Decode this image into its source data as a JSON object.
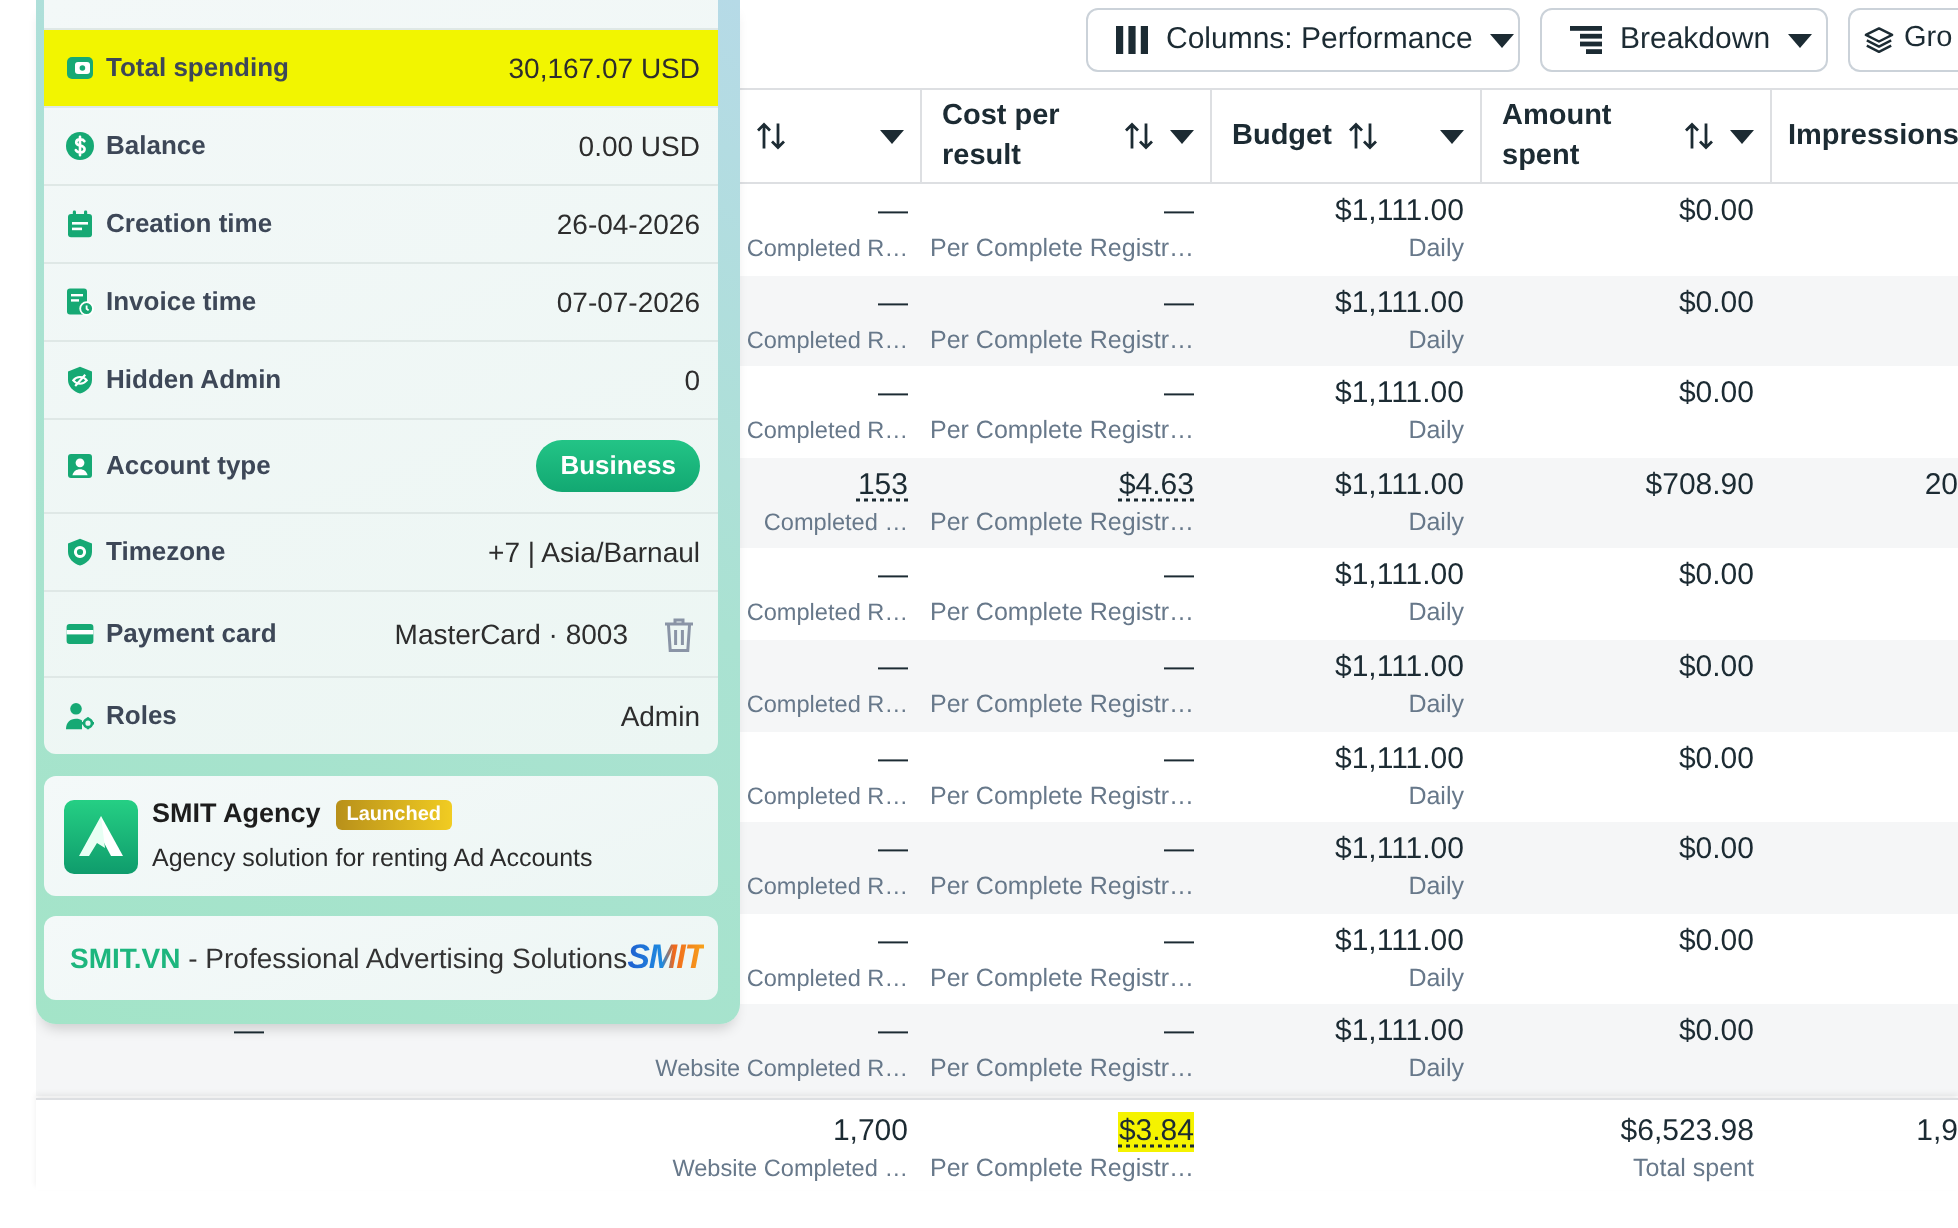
{
  "toolbar": {
    "buttons": [
      {
        "kind": "columns",
        "label": "Columns: Performance",
        "dropdown": true
      },
      {
        "kind": "breakdown",
        "label": "Breakdown",
        "dropdown": true
      },
      {
        "kind": "group",
        "label": "Gro",
        "dropdown": false
      }
    ]
  },
  "table": {
    "columns": [
      {
        "kind": "results"
      },
      {
        "kind": "cost",
        "label": "Cost per result"
      },
      {
        "kind": "budget",
        "label": "Budget"
      },
      {
        "kind": "amount",
        "label": "Amount spent"
      },
      {
        "kind": "impressions",
        "label": "Impressions"
      }
    ],
    "rows": [
      {
        "results": "—",
        "results_note": "Completed R…",
        "cost": "—",
        "cost_note": "Per Complete Registr…",
        "budget": "$1,111.00",
        "budget_note": "Daily",
        "amount": "$0.00",
        "underlined": false
      },
      {
        "results": "—",
        "results_note": "Completed R…",
        "cost": "—",
        "cost_note": "Per Complete Registr…",
        "budget": "$1,111.00",
        "budget_note": "Daily",
        "amount": "$0.00",
        "underlined": false
      },
      {
        "results": "—",
        "results_note": "Completed R…",
        "cost": "—",
        "cost_note": "Per Complete Registr…",
        "budget": "$1,111.00",
        "budget_note": "Daily",
        "amount": "$0.00",
        "underlined": false
      },
      {
        "results": "153",
        "results_note": "Completed …",
        "cost": "$4.63",
        "cost_note": "Per Complete Registr…",
        "budget": "$1,111.00",
        "budget_note": "Daily",
        "amount": "$708.90",
        "impressions": "20",
        "underlined": true
      },
      {
        "results": "—",
        "results_note": "Completed R…",
        "cost": "—",
        "cost_note": "Per Complete Registr…",
        "budget": "$1,111.00",
        "budget_note": "Daily",
        "amount": "$0.00",
        "underlined": false
      },
      {
        "results": "—",
        "results_note": "Completed R…",
        "cost": "—",
        "cost_note": "Per Complete Registr…",
        "budget": "$1,111.00",
        "budget_note": "Daily",
        "amount": "$0.00",
        "underlined": false
      },
      {
        "results": "—",
        "results_note": "Completed R…",
        "cost": "—",
        "cost_note": "Per Complete Registr…",
        "budget": "$1,111.00",
        "budget_note": "Daily",
        "amount": "$0.00",
        "underlined": false
      },
      {
        "results": "—",
        "results_note": "Completed R…",
        "cost": "—",
        "cost_note": "Per Complete Registr…",
        "budget": "$1,111.00",
        "budget_note": "Daily",
        "amount": "$0.00",
        "underlined": false
      },
      {
        "results": "—",
        "results_note": "Completed R…",
        "cost": "—",
        "cost_note": "Per Complete Registr…",
        "budget": "$1,111.00",
        "budget_note": "Daily",
        "amount": "$0.00",
        "underlined": false
      },
      {
        "column_1": "—",
        "results": "—",
        "results_note": "Website Completed R…",
        "cost": "—",
        "cost_note": "Per Complete Registr…",
        "budget": "$1,111.00",
        "budget_note": "Daily",
        "amount": "$0.00",
        "underlined": false
      }
    ],
    "footer": {
      "cells": [
        {
          "kind": "results",
          "value": "1,700",
          "note": "Website Completed …",
          "underlined": false,
          "highlighted": false
        },
        {
          "kind": "cost",
          "value": "$3.84",
          "note": "Per Complete Registr…",
          "underlined": true,
          "highlighted": true
        },
        {
          "kind": "amount",
          "value": "$6,523.98",
          "note": "Total spent",
          "underlined": false,
          "highlighted": false
        },
        {
          "kind": "impressions",
          "value": "1,9",
          "underlined": false,
          "highlighted": false
        }
      ]
    }
  },
  "account_panel": {
    "items": [
      {
        "kind": "spending",
        "label": "Total spending",
        "value": "30,167.07 USD",
        "highlighted": true
      },
      {
        "kind": "balance",
        "label": "Balance",
        "value": "0.00 USD",
        "highlighted": false
      },
      {
        "kind": "created",
        "label": "Creation time",
        "value": "26-04-2026",
        "highlighted": false
      },
      {
        "kind": "invoice",
        "label": "Invoice time",
        "value": "07-07-2026",
        "highlighted": false
      },
      {
        "kind": "admin",
        "label": "Hidden Admin",
        "value": "0",
        "highlighted": false
      },
      {
        "kind": "type",
        "label": "Account type",
        "value": "Business",
        "highlighted": false
      },
      {
        "kind": "timezone",
        "label": "Timezone",
        "value": "+7 | Asia/Barnaul",
        "highlighted": false
      },
      {
        "kind": "card",
        "label": "Payment card",
        "value": "MasterCard · 8003",
        "highlighted": false
      },
      {
        "kind": "roles",
        "label": "Roles",
        "value": "Admin",
        "highlighted": false
      }
    ],
    "agency": {
      "title": "SMIT Agency",
      "badge": "Launched",
      "description": "Agency solution for renting Ad Accounts"
    },
    "banner": {
      "brand": "SMIT.VN",
      "tagline": "- Professional Advertising Solutions",
      "logo": "SMIT"
    }
  }
}
